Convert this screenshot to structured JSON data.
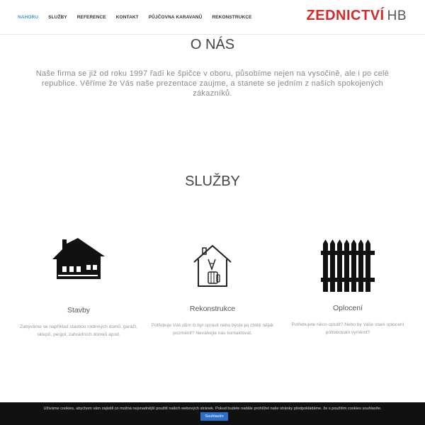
{
  "nav": {
    "items": [
      {
        "label": "NAHORU",
        "active": true
      },
      {
        "label": "SLUŽBY"
      },
      {
        "label": "REFERENCE"
      },
      {
        "label": "KONTAKT"
      },
      {
        "label": "PŮJČOVNA KARAVANŮ"
      },
      {
        "label": "REKONSTRUKCE"
      }
    ]
  },
  "logo": {
    "main": "ZEDNICTVÍ",
    "suffix": "HB",
    "color": "#d42a2a"
  },
  "about": {
    "title": "O NÁS",
    "text": "Naše firma se již od roku 1997 řadí ke špičce v oboru, působíme nejen na vysočině, ale i po celé republice. Věříme že Vás naše prezentace zaujme, a stanete se jedním z našich spokojených zákazníků."
  },
  "services": {
    "title": "SLUŽBY",
    "items": [
      {
        "name": "Stavby",
        "icon": "house-icon",
        "desc": "Zabýváme se například stavbou rodinných domů, garáží, sklepů, pergol, zahradních domků apod."
      },
      {
        "name": "Rekonstrukce",
        "icon": "house-renovation-icon",
        "desc": "Potřebuje Váš dům či byt opravit nebo byste jej chtěli nějak pozměnit? Neváhejte nás kontaktovat."
      },
      {
        "name": "Oplocení",
        "icon": "fence-icon",
        "desc": "Potřebujete něco oplotit? Nebo by Vaše staré oplocení potřebovalo vyměnit?"
      }
    ]
  },
  "cookie": {
    "text": "Užíváme cookies, abychom vám zajistili co možná nejsnadnější použití našich webových stránek. Pokud budete nadále prohlížet naše stránky předpokládáme, že s použitím cookies souhlasíte.",
    "button": "Souhlasím"
  }
}
